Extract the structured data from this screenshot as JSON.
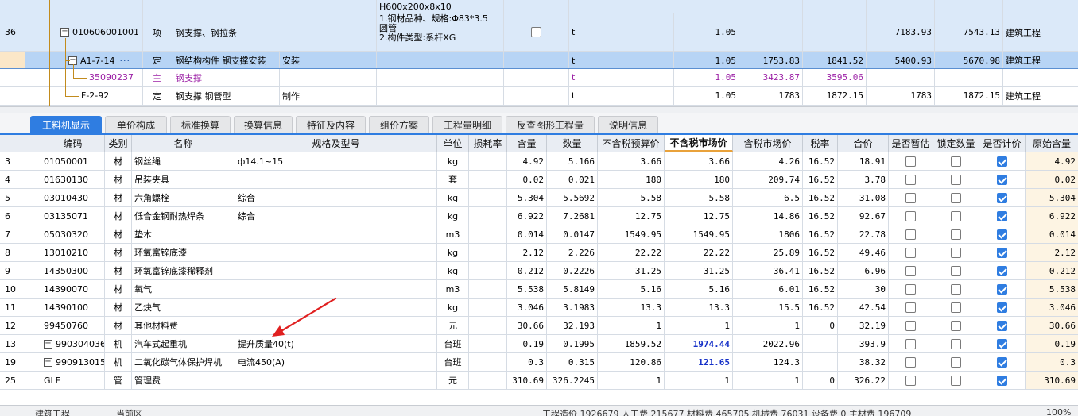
{
  "upper": {
    "partial_top": "H600x200x8x10",
    "rows": [
      {
        "num": "36",
        "code": "010606001001",
        "type": "项",
        "name": "钢支撑、钢拉条",
        "spec_lines": [
          "1.钢材品种、规格:Φ83*3.5",
          "圆管",
          "2.构件类型:系杆XG"
        ],
        "unit": "t",
        "qty": "1.05",
        "c1": "",
        "c2": "",
        "c3": "7183.93",
        "c4": "7543.13",
        "major": "建筑工程"
      },
      {
        "code": "A1-7-14",
        "dots": "···",
        "type": "定",
        "name": "钢结构构件 钢支撑安装",
        "extra": "安装",
        "unit": "t",
        "qty": "1.05",
        "c1": "1753.83",
        "c2": "1841.52",
        "c3": "5400.93",
        "c4": "5670.98",
        "major": "建筑工程"
      },
      {
        "code": "35090237",
        "type": "主",
        "name": "钢支撑",
        "extra": "",
        "unit": "t",
        "qty": "1.05",
        "c1": "3423.87",
        "c2": "3595.06",
        "c3": "",
        "c4": "",
        "major": ""
      },
      {
        "code": "F-2-92",
        "type": "定",
        "name": "钢支撑 钢管型",
        "extra": "制作",
        "unit": "t",
        "qty": "1.05",
        "c1": "1783",
        "c2": "1872.15",
        "c3": "1783",
        "c4": "1872.15",
        "major": "建筑工程"
      }
    ]
  },
  "tabs": [
    "工料机显示",
    "单价构成",
    "标准换算",
    "换算信息",
    "特征及内容",
    "组价方案",
    "工程量明细",
    "反查图形工程量",
    "说明信息"
  ],
  "grid": {
    "headers": [
      "编码",
      "类别",
      "名称",
      "规格及型号",
      "单位",
      "损耗率",
      "含量",
      "数量",
      "不含税预算价",
      "不含税市场价",
      "含税市场价",
      "税率",
      "合价",
      "是否暂估",
      "锁定数量",
      "是否计价",
      "原始含量"
    ],
    "rows": [
      {
        "n": "3",
        "code": "01050001",
        "cat": "材",
        "name": "钢丝绳",
        "spec": "ф14.1~15",
        "unit": "kg",
        "loss": "",
        "content": "4.92",
        "qty": "5.166",
        "budget": "3.66",
        "market": "3.66",
        "taxmarket": "4.26",
        "rate": "16.52",
        "total": "18.91",
        "orig": "4.92"
      },
      {
        "n": "4",
        "code": "01630130",
        "cat": "材",
        "name": "吊装夹具",
        "spec": "",
        "unit": "套",
        "loss": "",
        "content": "0.02",
        "qty": "0.021",
        "budget": "180",
        "market": "180",
        "taxmarket": "209.74",
        "rate": "16.52",
        "total": "3.78",
        "orig": "0.02"
      },
      {
        "n": "5",
        "code": "03010430",
        "cat": "材",
        "name": "六角螺栓",
        "spec": "综合",
        "unit": "kg",
        "loss": "",
        "content": "5.304",
        "qty": "5.5692",
        "budget": "5.58",
        "market": "5.58",
        "taxmarket": "6.5",
        "rate": "16.52",
        "total": "31.08",
        "orig": "5.304"
      },
      {
        "n": "6",
        "code": "03135071",
        "cat": "材",
        "name": "低合金钢耐热焊条",
        "spec": "综合",
        "unit": "kg",
        "loss": "",
        "content": "6.922",
        "qty": "7.2681",
        "budget": "12.75",
        "market": "12.75",
        "taxmarket": "14.86",
        "rate": "16.52",
        "total": "92.67",
        "orig": "6.922"
      },
      {
        "n": "7",
        "code": "05030320",
        "cat": "材",
        "name": "垫木",
        "spec": "",
        "unit": "m3",
        "loss": "",
        "content": "0.014",
        "qty": "0.0147",
        "budget": "1549.95",
        "market": "1549.95",
        "taxmarket": "1806",
        "rate": "16.52",
        "total": "22.78",
        "orig": "0.014"
      },
      {
        "n": "8",
        "code": "13010210",
        "cat": "材",
        "name": "环氧富锌底漆",
        "spec": "",
        "unit": "kg",
        "loss": "",
        "content": "2.12",
        "qty": "2.226",
        "budget": "22.22",
        "market": "22.22",
        "taxmarket": "25.89",
        "rate": "16.52",
        "total": "49.46",
        "orig": "2.12"
      },
      {
        "n": "9",
        "code": "14350300",
        "cat": "材",
        "name": "环氧富锌底漆稀释剂",
        "spec": "",
        "unit": "kg",
        "loss": "",
        "content": "0.212",
        "qty": "0.2226",
        "budget": "31.25",
        "market": "31.25",
        "taxmarket": "36.41",
        "rate": "16.52",
        "total": "6.96",
        "orig": "0.212"
      },
      {
        "n": "10",
        "code": "14390070",
        "cat": "材",
        "name": "氧气",
        "spec": "",
        "unit": "m3",
        "loss": "",
        "content": "5.538",
        "qty": "5.8149",
        "budget": "5.16",
        "market": "5.16",
        "taxmarket": "6.01",
        "rate": "16.52",
        "total": "30",
        "orig": "5.538"
      },
      {
        "n": "11",
        "code": "14390100",
        "cat": "材",
        "name": "乙炔气",
        "spec": "",
        "unit": "kg",
        "loss": "",
        "content": "3.046",
        "qty": "3.1983",
        "budget": "13.3",
        "market": "13.3",
        "taxmarket": "15.5",
        "rate": "16.52",
        "total": "42.54",
        "orig": "3.046"
      },
      {
        "n": "12",
        "code": "99450760",
        "cat": "材",
        "name": "其他材料费",
        "spec": "",
        "unit": "元",
        "loss": "",
        "content": "30.66",
        "qty": "32.193",
        "budget": "1",
        "market": "1",
        "taxmarket": "1",
        "rate": "0",
        "total": "32.19",
        "orig": "30.66"
      },
      {
        "n": "13",
        "code": "990304036",
        "expand": true,
        "cat": "机",
        "name": "汽车式起重机",
        "spec": "提升质量40(t)",
        "unit": "台班",
        "loss": "",
        "content": "0.19",
        "qty": "0.1995",
        "budget": "1859.52",
        "market": "1974.44",
        "market_hl": true,
        "taxmarket": "2022.96",
        "rate": "",
        "total": "393.9",
        "orig": "0.19"
      },
      {
        "n": "19",
        "code": "990913015",
        "expand": true,
        "cat": "机",
        "name": "二氧化碳气体保护焊机",
        "spec": "电流450(A)",
        "unit": "台班",
        "loss": "",
        "content": "0.3",
        "qty": "0.315",
        "budget": "120.86",
        "market": "121.65",
        "market_hl": true,
        "taxmarket": "124.3",
        "rate": "",
        "total": "38.32",
        "orig": "0.3"
      },
      {
        "n": "25",
        "code": "GLF",
        "cat": "管",
        "name": "管理费",
        "spec": "",
        "unit": "元",
        "loss": "",
        "content": "310.69",
        "qty": "326.2245",
        "budget": "1",
        "market": "1",
        "taxmarket": "1",
        "rate": "0",
        "total": "326.22",
        "orig": "310.69"
      }
    ]
  },
  "status": {
    "left1": "建筑工程",
    "left2": "当前区",
    "summary": "工程造价 1926679  人工费 215677  材料费 465705  机械费 76031  设备费 0  主材费 196709",
    "zoom": "100%"
  },
  "colors": {
    "accent": "#2f7de1",
    "selected_row": "#b7d4f5",
    "highlight_value": "#1530c8",
    "arrow": "#e02020"
  }
}
